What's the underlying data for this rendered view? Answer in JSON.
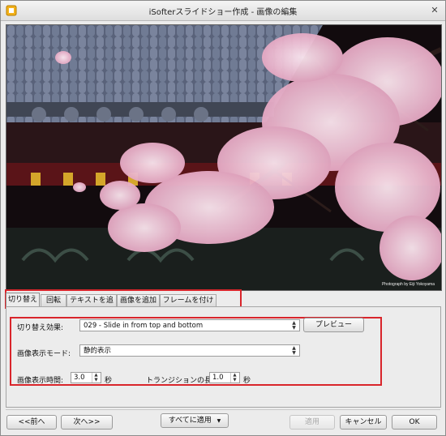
{
  "window": {
    "title": "iSofterスライドショー作成 - 画像の編集",
    "close_glyph": "✕"
  },
  "photo": {
    "credit": "Photograph by Eiji Yokoyama"
  },
  "tabs": [
    {
      "label": "切り替え",
      "active": true
    },
    {
      "label": "回転"
    },
    {
      "label": "テキストを追加"
    },
    {
      "label": "画像を追加"
    },
    {
      "label": "フレームを付ける"
    }
  ],
  "transition": {
    "effect_label": "切り替え効果:",
    "effect_value": "029 - Slide in from top and bottom",
    "preview_label": "プレビュー",
    "mode_label": "画像表示モード:",
    "mode_value": "静的表示",
    "duration_label": "画像表示時間:",
    "duration_value": "3.0",
    "duration_unit": "秒",
    "trans_len_label": "トランジションの長さ:",
    "trans_len_value": "1.0",
    "trans_len_unit": "秒"
  },
  "footer": {
    "prev": "<<前へ",
    "next": "次へ>>",
    "apply_all": "すべてに適用",
    "apply": "適用",
    "cancel": "キャンセル",
    "ok": "OK"
  },
  "colors": {
    "highlight": "#d9252b",
    "roof": "#4a5366",
    "blossom": "#f2c7d8"
  }
}
